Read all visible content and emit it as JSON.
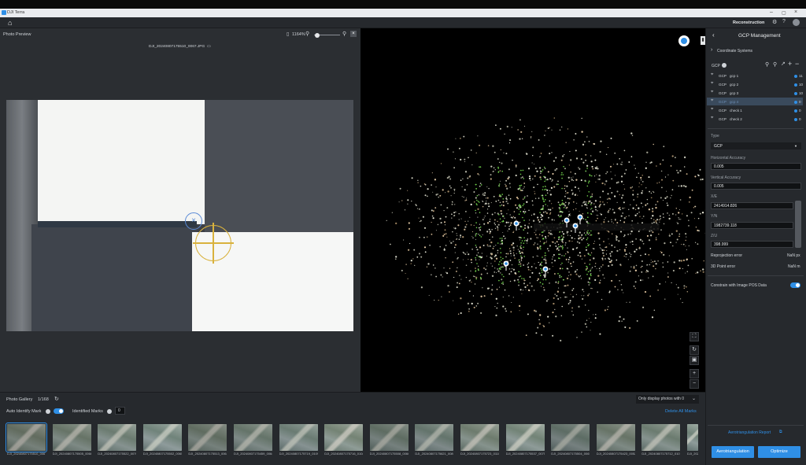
{
  "app": {
    "title": "DJI Terra",
    "mode": "Reconstruction"
  },
  "photo_preview": {
    "title": "Photo Preview",
    "zoom": "1164%",
    "filename": "DJI_20240807175510_0067.JPG"
  },
  "gcp_panel": {
    "title": "GCP Management",
    "coordinate_systems": "Coordinate Systems",
    "gcp_header": "GCP",
    "points": [
      {
        "kind": "GCP",
        "name": "gcp 1",
        "count": "11"
      },
      {
        "kind": "GCP",
        "name": "gcp 2",
        "count": "10"
      },
      {
        "kind": "GCP",
        "name": "gcp 3",
        "count": "10"
      },
      {
        "kind": "GCP",
        "name": "gcp 4",
        "count": "0"
      },
      {
        "kind": "GCP",
        "name": "check 1",
        "count": "0"
      },
      {
        "kind": "GCP",
        "name": "check 2",
        "count": "0"
      }
    ],
    "type_label": "Type",
    "type_value": "GCP",
    "horizontal_accuracy_label": "Horizontal Accuracy",
    "horizontal_accuracy": "0.005",
    "vertical_accuracy_label": "Vertical Accuracy",
    "vertical_accuracy": "0.005",
    "x_label": "X/E",
    "x_value": "2414914.826",
    "y_label": "Y/N",
    "y_value": "1982739.118",
    "z_label": "Z/U",
    "z_value": "398.999",
    "reprojection_error_label": "Reprojection error",
    "reprojection_error": "NaN px",
    "point_error_label": "3D Point error",
    "point_error": "NaN m",
    "constrain_label": "Constrain with Image POS Data",
    "aerotriangulation_report": "Aerotriangulation Report",
    "aerotriangulation_button": "Aerotriangulation",
    "optimize_button": "Optimize"
  },
  "gallery": {
    "title": "Photo Gallery",
    "count": "1/168",
    "auto_identify": "Auto Identify Mark",
    "identified_marks": "Identified Marks",
    "identified_count": "0",
    "filter": "Only display photos with 0",
    "delete_all": "Delete All Marks",
    "thumbs": [
      "DJI_20240807175510_0067",
      "DJI_20240807175505_0066",
      "DJI_20240807175522_0070",
      "DJI_20240807175502_0065",
      "DJI_20240807175513_0068",
      "DJI_20240807175459_0064",
      "DJI_20240807175719_0109",
      "DJI_20240807175716_0108",
      "DJI_20240807175508_0066",
      "DJI_20240807175621_0089",
      "DJI_20240807175723_0110",
      "DJI_20240807175537_0075",
      "DJI_20240807175504_0065",
      "DJI_20240807175423_0052",
      "DJI_20240807175712_0107",
      "DJI_20240807175714"
    ]
  },
  "colors": {
    "accent": "#2f8fe6",
    "panel": "#26292d",
    "viewport": "#000000"
  }
}
